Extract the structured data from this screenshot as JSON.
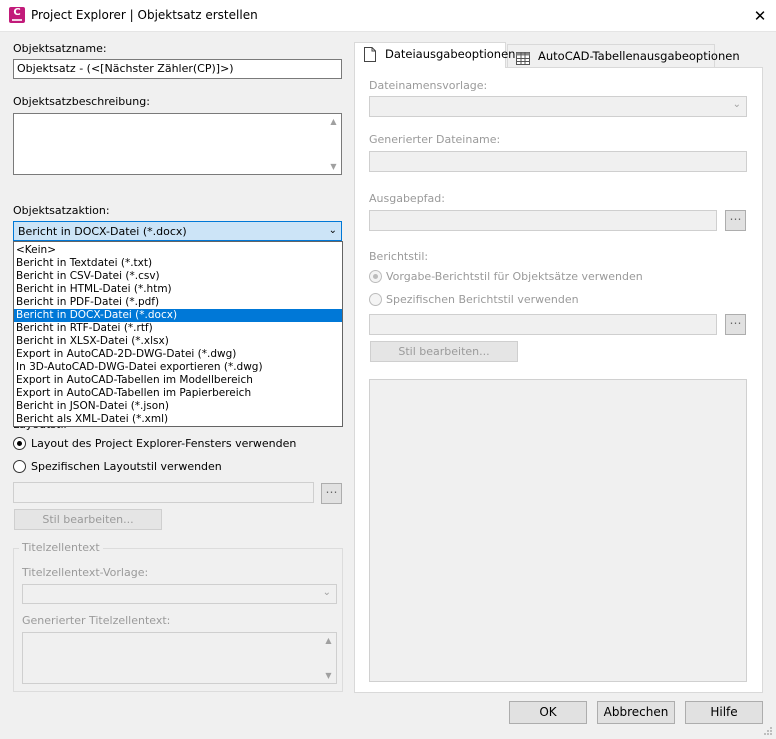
{
  "window": {
    "title": "Project Explorer | Objektsatz erstellen",
    "app_icon_letter": "C",
    "close_glyph": "✕"
  },
  "left": {
    "name_label": "Objektsatzname:",
    "name_value": "Objektsatz - (<[Nächster Zähler(CP)]>)",
    "description_label": "Objektsatzbeschreibung:",
    "action_label": "Objektsatzaktion:",
    "action_selected": "Bericht in DOCX-Datei (*.docx)",
    "action_options": [
      "<Kein>",
      "Bericht in Textdatei (*.txt)",
      "Bericht in CSV-Datei (*.csv)",
      "Bericht in HTML-Datei (*.htm)",
      "Bericht in PDF-Datei (*.pdf)",
      "Bericht in DOCX-Datei (*.docx)",
      "Bericht in RTF-Datei (*.rtf)",
      "Bericht in XLSX-Datei (*.xlsx)",
      "Export in AutoCAD-2D-DWG-Datei (*.dwg)",
      "In 3D-AutoCAD-DWG-Datei exportieren (*.dwg)",
      "Export in AutoCAD-Tabellen im Modellbereich",
      "Export in AutoCAD-Tabellen im Papierbereich",
      "Bericht in JSON-Datei (*.json)",
      "Bericht als XML-Datei (*.xml)"
    ],
    "layout_label": "Layoutstil",
    "radio_layout_explorer": "Layout des Project Explorer-Fensters verwenden",
    "radio_layout_specific": "Spezifischen Layoutstil verwenden",
    "edit_style_button": "Stil bearbeiten...",
    "title_group_label": "Titelzellentext",
    "title_template_label": "Titelzellentext-Vorlage:",
    "generated_title_label": "Generierter Titelzellentext:"
  },
  "tabs": [
    {
      "label": "Dateiausgabeoptionen",
      "icon": "document-icon",
      "active": true
    },
    {
      "label": "AutoCAD-Tabellenausgabeoptionen",
      "icon": "table-icon",
      "active": false
    }
  ],
  "file_tab": {
    "filename_template_label": "Dateinamensvorlage:",
    "generated_filename_label": "Generierter Dateiname:",
    "output_path_label": "Ausgabepfad:",
    "report_style_label": "Berichtstil:",
    "radio_default_style": "Vorgabe-Berichtstil für Objektsätze verwenden",
    "radio_specific_style": "Spezifischen Berichtstil verwenden",
    "edit_style_button": "Stil bearbeiten..."
  },
  "footer": {
    "ok": "OK",
    "cancel": "Abbrechen",
    "help": "Hilfe"
  },
  "colors": {
    "accent": "#0078d7",
    "selected_combo_bg": "#cce4f7",
    "app_icon": "#c21b7a"
  }
}
